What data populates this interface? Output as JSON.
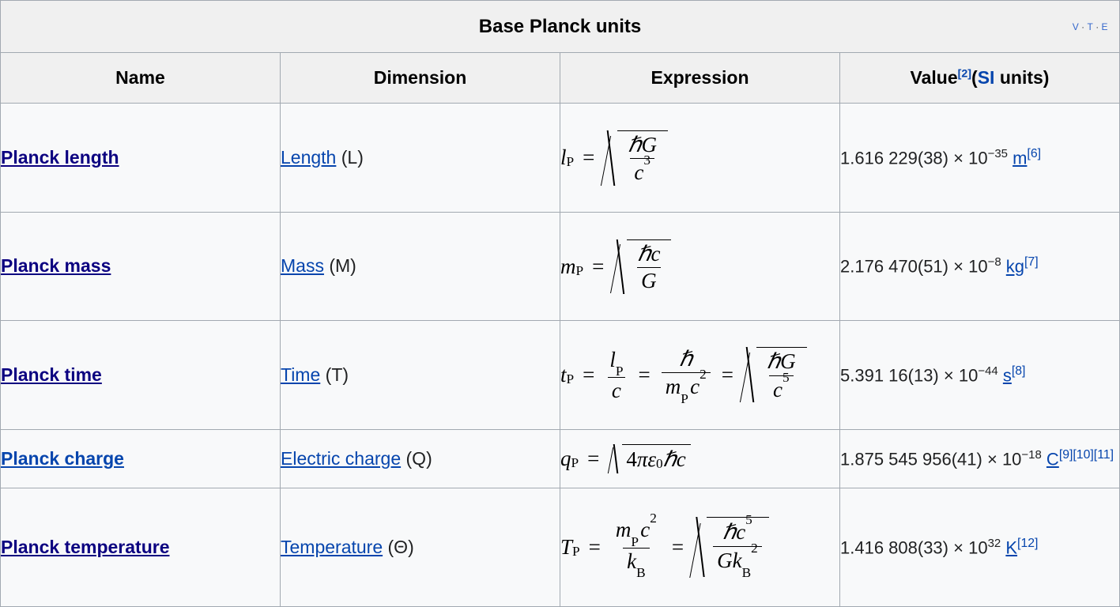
{
  "table": {
    "caption": "Base Planck units",
    "vte": {
      "v": "V",
      "t": "T",
      "e": "E",
      "sep": "·"
    },
    "headers": {
      "name": "Name",
      "dimension": "Dimension",
      "expression": "Expression",
      "value_prefix": "Value",
      "value_ref": "[2]",
      "value_paren_open": "(",
      "value_si": "SI",
      "value_units": " units",
      "value_paren_close": ")"
    },
    "rows": [
      {
        "name": "Planck length",
        "name_link_state": "visited",
        "dimension_link": "Length",
        "dimension_symbol": "(L)",
        "expression_text": "l_P = sqrt(ħG / c^3)",
        "value_number": "1.616 229(38)",
        "value_times": "×",
        "value_base": "10",
        "value_exponent": "−35",
        "value_unit": "m",
        "value_refs": "[6]"
      },
      {
        "name": "Planck mass",
        "name_link_state": "visited",
        "dimension_link": "Mass",
        "dimension_symbol": "(M)",
        "expression_text": "m_P = sqrt(ħc / G)",
        "value_number": "2.176 470(51)",
        "value_times": "×",
        "value_base": "10",
        "value_exponent": "−8",
        "value_unit": "kg",
        "value_refs": "[7]"
      },
      {
        "name": "Planck time",
        "name_link_state": "visited",
        "dimension_link": "Time",
        "dimension_symbol": "(T)",
        "expression_text": "t_P = l_P/c = ħ/(m_P c^2) = sqrt(ħG / c^5)",
        "value_number": "5.391 16(13)",
        "value_times": "×",
        "value_base": "10",
        "value_exponent": "−44",
        "value_unit": "s",
        "value_refs": "[8]"
      },
      {
        "name": "Planck charge",
        "name_link_state": "unvisited",
        "dimension_link": "Electric charge",
        "dimension_symbol": "(Q)",
        "expression_text": "q_P = sqrt(4πε₀ħc)",
        "value_number": "1.875 545 956(41)",
        "value_times": "×",
        "value_base": "10",
        "value_exponent": "−18",
        "value_unit": "C",
        "value_refs": "[9][10][11]"
      },
      {
        "name": "Planck temperature",
        "name_link_state": "visited",
        "dimension_link": "Temperature",
        "dimension_symbol": "(Θ)",
        "expression_text": "T_P = m_P c^2 / k_B = sqrt(ħc^5 / (G k_B^2))",
        "value_number": "1.416 808(33)",
        "value_times": "×",
        "value_base": "10",
        "value_exponent": "32",
        "value_unit": "K",
        "value_refs": "[12]"
      }
    ],
    "math_symbols": {
      "l": "l",
      "m": "m",
      "t": "t",
      "q": "q",
      "T": "T",
      "P": "P",
      "B": "B",
      "eq": "=",
      "hbar": "ħ",
      "G": "G",
      "c": "c",
      "k": "k",
      "four": "4",
      "pi": "π",
      "eps": "ε",
      "zero": "0",
      "two": "2",
      "three": "3",
      "five": "5"
    },
    "colors": {
      "link": "#0645ad",
      "link_visited": "#0b0080",
      "border": "#a2a9b1",
      "header_bg": "#f0f0f0",
      "body_bg": "#f8f9fa"
    }
  }
}
